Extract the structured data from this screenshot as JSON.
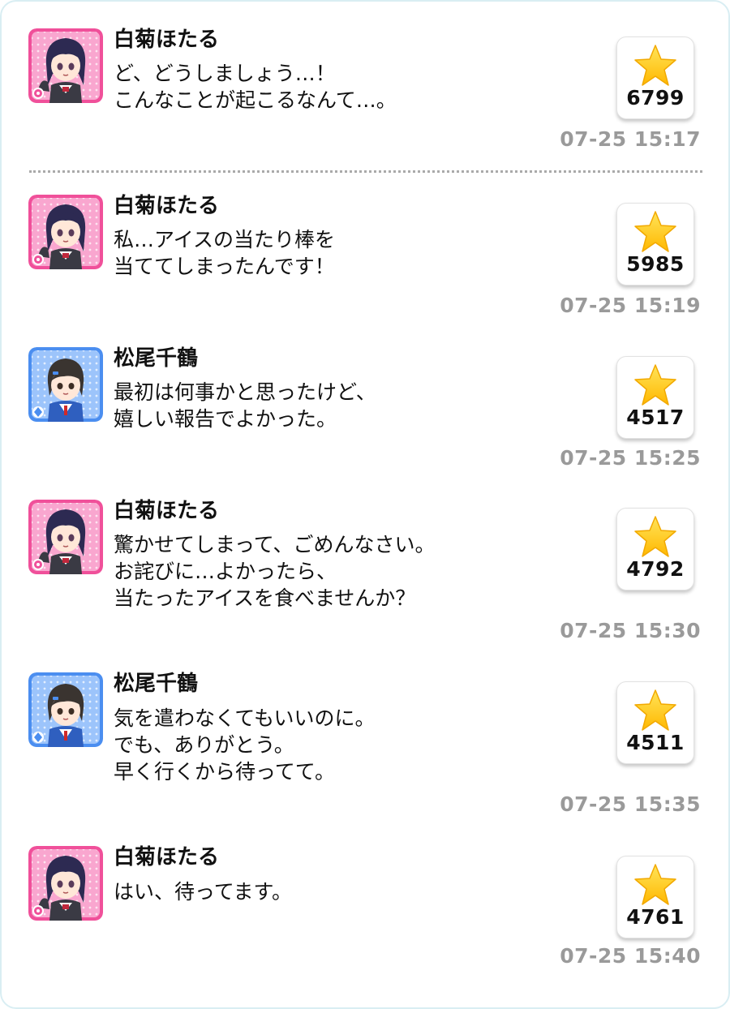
{
  "posts": [
    {
      "name": "白菊ほたる",
      "avatar": "hotaru-avatar",
      "lines": [
        "ど、どうしましょう…！",
        "こんなことが起こるなんて…。"
      ],
      "likes": "6799",
      "time": "07-25 15:17"
    },
    {
      "name": "白菊ほたる",
      "avatar": "hotaru-avatar",
      "lines": [
        "私…アイスの当たり棒を",
        "当ててしまったんです！"
      ],
      "likes": "5985",
      "time": "07-25 15:19"
    },
    {
      "name": "松尾千鶴",
      "avatar": "chizuru-avatar",
      "lines": [
        "最初は何事かと思ったけど、",
        "嬉しい報告でよかった。"
      ],
      "likes": "4517",
      "time": "07-25 15:25"
    },
    {
      "name": "白菊ほたる",
      "avatar": "hotaru-avatar",
      "lines": [
        "驚かせてしまって、ごめんなさい。",
        "お詫びに…よかったら、",
        "当たったアイスを食べませんか？"
      ],
      "likes": "4792",
      "time": "07-25 15:30"
    },
    {
      "name": "松尾千鶴",
      "avatar": "chizuru-avatar",
      "lines": [
        "気を遣わなくてもいいのに。",
        "でも、ありがとう。",
        "早く行くから待ってて。"
      ],
      "likes": "4511",
      "time": "07-25 15:35"
    },
    {
      "name": "白菊ほたる",
      "avatar": "hotaru-avatar",
      "lines": [
        "はい、待ってます。"
      ],
      "likes": "4761",
      "time": "07-25 15:40"
    }
  ],
  "colors": {
    "hotaru_frame": "#f0509a",
    "chizuru_frame": "#4b8ef0",
    "star": "#ffd000",
    "timestamp": "#9a9a9a"
  },
  "icons": {
    "like": "star-icon",
    "cute_badge": "flower-badge-icon",
    "cool_badge": "diamond-badge-icon"
  }
}
